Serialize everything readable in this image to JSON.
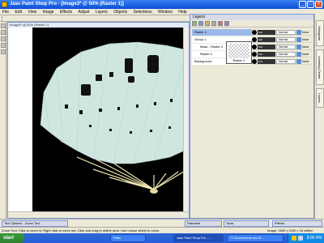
{
  "window": {
    "title": "Jasc Paint Shop Pro - [Image3* @ 50% (Raster 1)]"
  },
  "menu": [
    "File",
    "Edit",
    "View",
    "Image",
    "Effects",
    "Adjust",
    "Layers",
    "Objects",
    "Selections",
    "Window",
    "Help"
  ],
  "document": {
    "title": "Image3* @ 50% (Raster 1)"
  },
  "layers_palette": {
    "title": "Layers",
    "rows": [
      {
        "name": "Raster 1",
        "opacity": "100",
        "blend": "Normal",
        "link": "None"
      },
      {
        "name": "Group 1",
        "opacity": "100",
        "blend": "Normal",
        "link": "None"
      },
      {
        "name": "Mask - Raster 2",
        "opacity": "100",
        "blend": "Normal",
        "link": "None"
      },
      {
        "name": "Raster 2",
        "opacity": "100",
        "blend": "Normal",
        "link": "None"
      },
      {
        "name": "Background",
        "opacity": "100",
        "blend": "Normal",
        "link": "None"
      }
    ],
    "thumb_label": "Raster 1"
  },
  "right_tabs": [
    "Histogram",
    "Learning Center",
    "Layers"
  ],
  "bottom_panels": {
    "tool_options": "Tool Options - Zoom Tool",
    "standard": "Standard",
    "tools": "Tools",
    "effects": "Effects"
  },
  "status": {
    "left": "Zoom Tool: Click to zoom in; Right click to zoom out; Click and drag to define area. Use mouse wheel to zoom.",
    "right": "Image: 1600 x 1200 x 16 million"
  },
  "taskbar": {
    "start": "start",
    "tasks": [
      "Paris",
      "Jasc Paint Shop Pro -...",
      "\"C:\\Documents and S..."
    ],
    "clock": "8:00 PM"
  },
  "colors": {
    "accent": "#0a4fd4",
    "fan": "#cfe6e0",
    "ribs": "#f1e7b0"
  }
}
